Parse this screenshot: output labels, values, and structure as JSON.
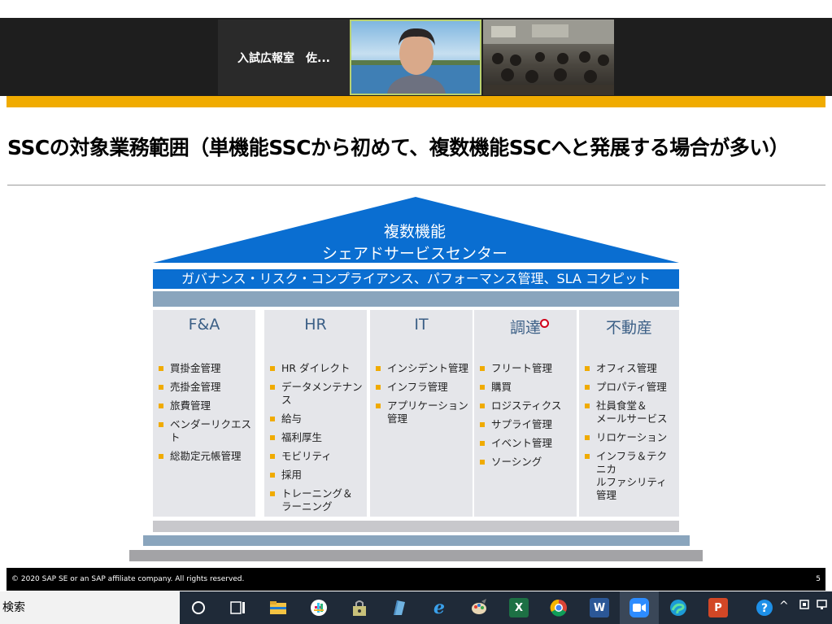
{
  "zoom": {
    "participant_name": "入試広報室　佐..."
  },
  "slide": {
    "title": "SSCの対象業務範囲（単機能SSCから初めて、複数機能SSCへと発展する場合が多い）",
    "roof_line1": "複数機能",
    "roof_line2": "シェアドサービスセンター",
    "governance": "ガバナンス・リスク・コンプライアンス、パフォーマンス管理、SLA コクピット",
    "columns": [
      {
        "title": "F&A",
        "items": [
          "買掛金管理",
          "売掛金管理",
          "旅費管理",
          "ベンダーリクエスト",
          "総勘定元帳管理"
        ]
      },
      {
        "title": "HR",
        "items": [
          "HR ダイレクト",
          "データメンテナンス",
          "給与",
          "福利厚生",
          "モビリティ",
          "採用",
          "トレーニング＆\nラーニング"
        ]
      },
      {
        "title": "IT",
        "items": [
          "インシデント管理",
          "インフラ管理",
          "アプリケーション\n管理"
        ]
      },
      {
        "title": "調達",
        "items": [
          "フリート管理",
          "購買",
          "ロジスティクス",
          "サプライ管理",
          "イベント管理",
          "ソーシング"
        ]
      },
      {
        "title": "不動産",
        "items": [
          "オフィス管理",
          "プロパティ管理",
          "社員食堂＆\nメールサービス",
          "リロケーション",
          "インフラ＆テクニカ\nルファシリティ管理"
        ]
      }
    ],
    "footer_copyright": "© 2020 SAP SE or an SAP affiliate company. All rights reserved.",
    "page_number": "5"
  },
  "taskbar": {
    "search_label": "検索",
    "apps": [
      "task-view",
      "file-explorer",
      "slack",
      "keepass",
      "notes",
      "internet-explorer",
      "paint",
      "excel",
      "chrome",
      "word",
      "zoom",
      "edge",
      "powerpoint"
    ]
  },
  "colors": {
    "gold": "#f0ab00",
    "sap_blue": "#0a6ed1",
    "column_bg": "#e5e6ea"
  }
}
